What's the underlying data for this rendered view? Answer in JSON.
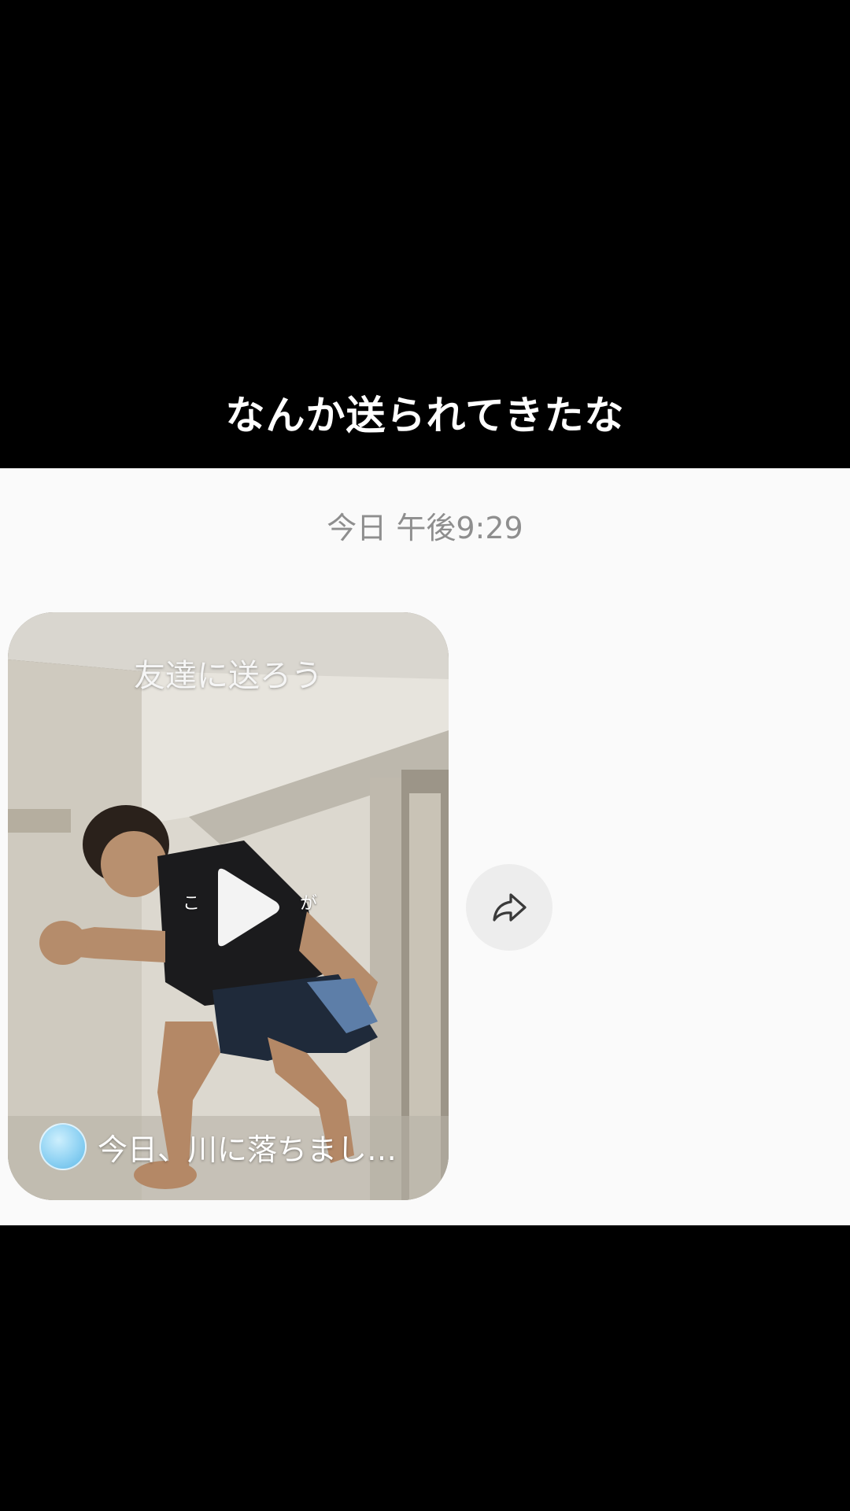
{
  "caption": "なんか送られてきたな",
  "chat": {
    "timestamp": "今日 午後9:29",
    "video_message": {
      "overlay_title": "友達に送ろう",
      "overlay_sub": "こ が",
      "footer_text": "今日、川に落ちまし…"
    }
  },
  "icons": {
    "play": "play-icon",
    "share": "share-arrow-icon",
    "avatar": "avatar"
  },
  "colors": {
    "chat_background": "#fafafa",
    "timestamp": "#8e8e8e",
    "share_button_bg": "#ededed"
  }
}
